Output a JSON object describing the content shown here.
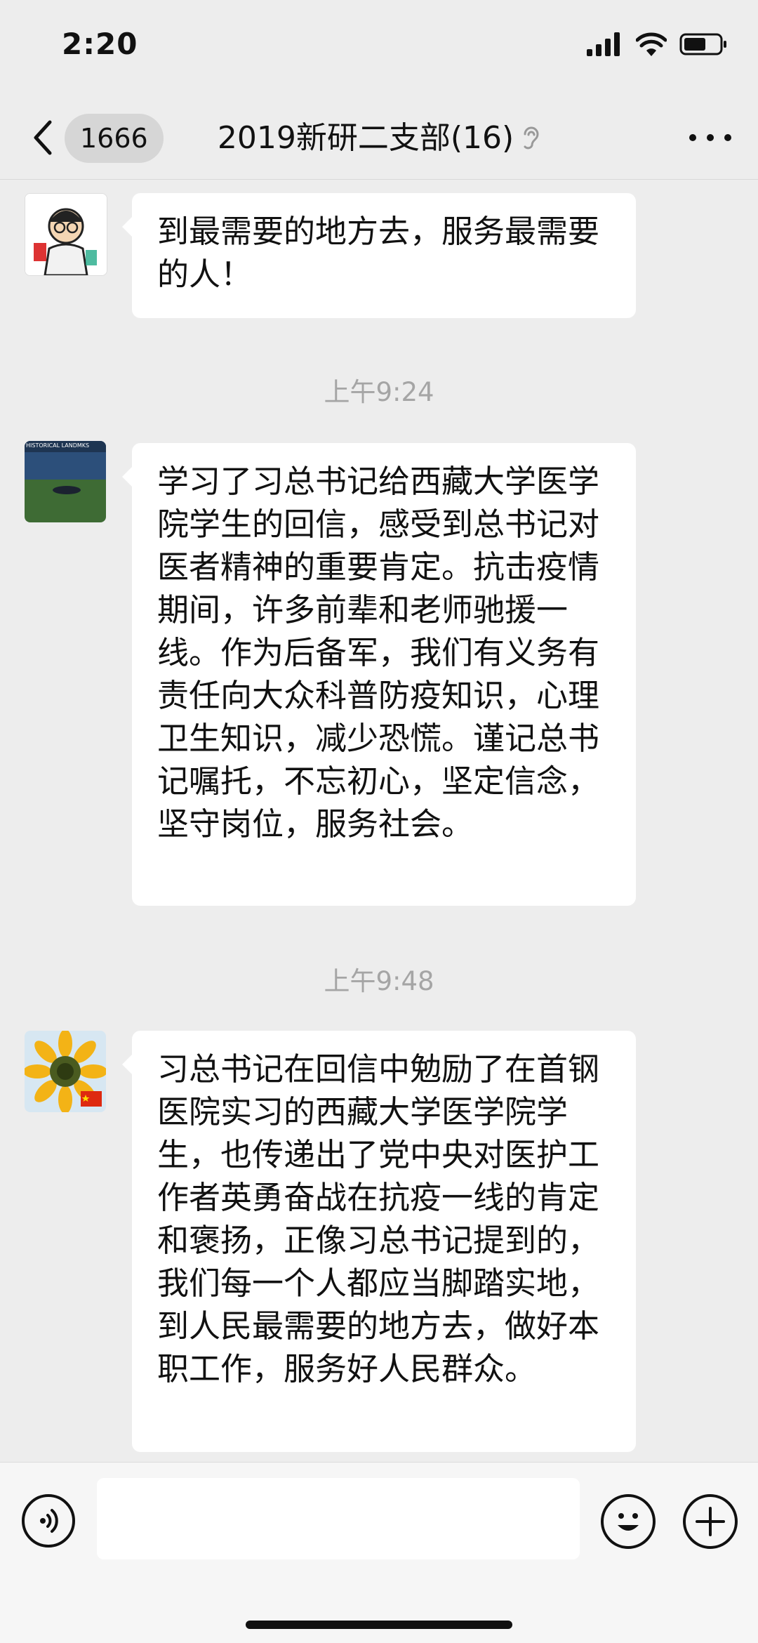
{
  "status_bar": {
    "time": "2:20"
  },
  "nav": {
    "unread_count": "1666",
    "title": "2019新研二支部(16)"
  },
  "messages": [
    {
      "text": "到最需要的地方去，服务最需要的人！",
      "avatar": "cartoon-doctor-avatar"
    },
    {
      "text": "学习了习总书记给西藏大学医学院学生的回信，感受到总书记对医者精神的重要肯定。抗击疫情期间，许多前辈和老师驰援一线。作为后备军，我们有义务有责任向大众科普防疫知识，心理卫生知识，减少恐慌。谨记总书记嘱托，不忘初心，坚定信念，坚守岗位，服务社会。",
      "avatar": "landscape-photo-avatar",
      "avatar_caption": "HISTORICAL LANDMKS"
    },
    {
      "text": "习总书记在回信中勉励了在首钢医院实习的西藏大学医学院学生，也传递出了党中央对医护工作者英勇奋战在抗疫一线的肯定和褒扬，正像习总书记提到的，我们每一个人都应当脚踏实地，到人民最需要的地方去，做好本职工作，服务好人民群众。",
      "avatar": "sunflower-avatar"
    }
  ],
  "timestamps": [
    "上午9:24",
    "上午9:48"
  ],
  "input": {
    "placeholder": ""
  },
  "icons": {
    "back": "chevron-left-icon",
    "mute": "ear-icon",
    "more": "more-dots-icon",
    "voice": "voice-icon",
    "emoji": "emoji-icon",
    "plus": "plus-icon"
  },
  "colors": {
    "background": "#ededed",
    "bubble": "#ffffff",
    "timestamp": "#a5a5a5"
  }
}
